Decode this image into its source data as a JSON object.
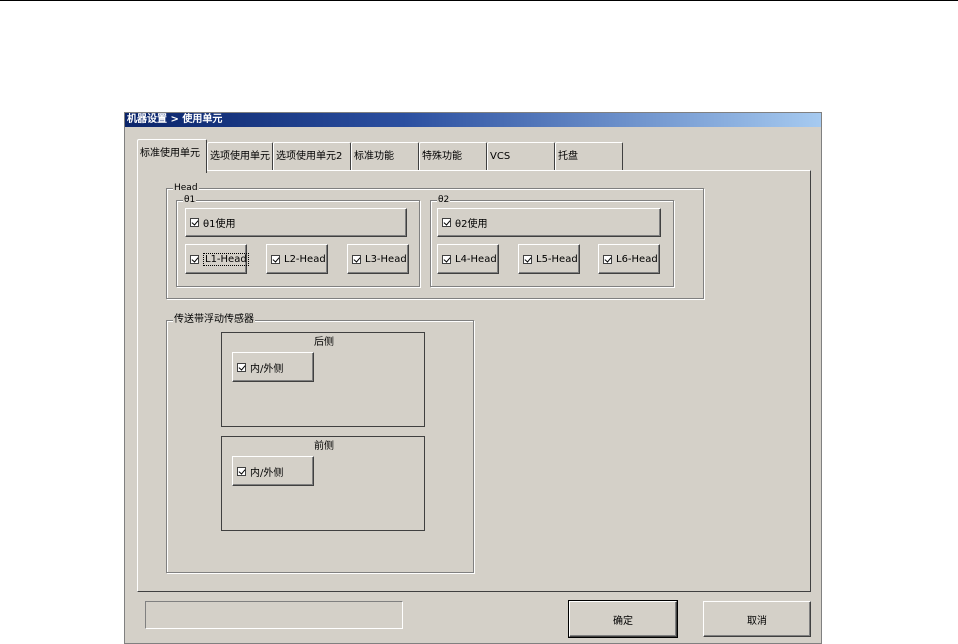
{
  "window": {
    "title": "机器设置 > 使用单元"
  },
  "tabs": [
    {
      "label": "标准使用单元",
      "active": true
    },
    {
      "label": "选项使用单元",
      "active": false
    },
    {
      "label": "选项使用单元2",
      "active": false
    },
    {
      "label": "标准功能",
      "active": false
    },
    {
      "label": "特殊功能",
      "active": false
    },
    {
      "label": "VCS",
      "active": false
    },
    {
      "label": "托盘",
      "active": false
    }
  ],
  "head_group": {
    "label": "Head",
    "beam1": {
      "label": "θ1",
      "use_label": "θ1使用",
      "use_checked": true,
      "heads": [
        {
          "label": "L1-Head",
          "checked": true
        },
        {
          "label": "L2-Head",
          "checked": true
        },
        {
          "label": "L3-Head",
          "checked": true
        }
      ]
    },
    "beam2": {
      "label": "θ2",
      "use_label": "θ2使用",
      "use_checked": true,
      "heads": [
        {
          "label": "L4-Head",
          "checked": true
        },
        {
          "label": "L5-Head",
          "checked": true
        },
        {
          "label": "L6-Head",
          "checked": true
        }
      ]
    }
  },
  "conveyor_group": {
    "label": "传送带浮动传感器",
    "rear": {
      "label": "后侧",
      "option_label": "内/外侧",
      "checked": true
    },
    "front": {
      "label": "前侧",
      "option_label": "内/外侧",
      "checked": true
    }
  },
  "footer": {
    "status_text": "",
    "ok_label": "确定",
    "cancel_label": "取消"
  }
}
